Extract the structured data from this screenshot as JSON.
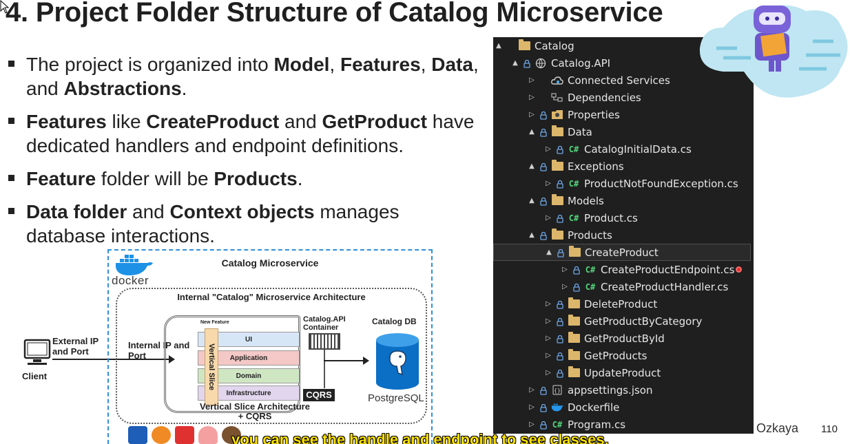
{
  "slide": {
    "title": "4. Project Folder Structure of Catalog Microservice",
    "page_number": "110",
    "author": "Ozkaya",
    "subtitle_caption": "you can see the handle and endpoint to see classes."
  },
  "bullets": [
    [
      {
        "t": "The project is organized into ",
        "b": false
      },
      {
        "t": "Model",
        "b": true
      },
      {
        "t": ", ",
        "b": false
      },
      {
        "t": "Features",
        "b": true
      },
      {
        "t": ", ",
        "b": false
      },
      {
        "t": "Data",
        "b": true
      },
      {
        "t": ", and ",
        "b": false
      },
      {
        "t": "Abstractions",
        "b": true
      },
      {
        "t": ".",
        "b": false
      }
    ],
    [
      {
        "t": "Features",
        "b": true
      },
      {
        "t": " like ",
        "b": false
      },
      {
        "t": "CreateProduct",
        "b": true
      },
      {
        "t": " and ",
        "b": false
      },
      {
        "t": "GetProduct",
        "b": true
      },
      {
        "t": " have dedicated handlers and endpoint definitions.",
        "b": false
      }
    ],
    [
      {
        "t": "Feature",
        "b": true
      },
      {
        "t": " folder will be ",
        "b": false
      },
      {
        "t": "Products",
        "b": true
      },
      {
        "t": ".",
        "b": false
      }
    ],
    [
      {
        "t": "Data folder",
        "b": true
      },
      {
        "t": " and ",
        "b": false
      },
      {
        "t": "Context objects",
        "b": true
      },
      {
        "t": " manages database interactions.",
        "b": false
      }
    ]
  ],
  "diagram": {
    "microservice_title": "Catalog Microservice",
    "docker_label": "docker",
    "inner_title": "Internal \"Catalog\" Microservice Architecture",
    "new_feature": "New Feature",
    "vertical_slice": "Vertical Slice",
    "layers": [
      "UI",
      "Application",
      "Domain",
      "Infrastructure"
    ],
    "caption": "Vertical Slice Architecture + CQRS",
    "cqrs": "CQRS",
    "api_container": "Catalog.API Container",
    "catalog_db": "Catalog DB",
    "postgres": "PostgreSQL",
    "internal_ip": "Internal IP and Port",
    "external_ip": "External IP and Port",
    "client": "Client"
  },
  "explorer": {
    "nodes": [
      {
        "label": "Catalog",
        "depth": 0,
        "exp": "▲",
        "icon": "folder",
        "lock": false
      },
      {
        "label": "Catalog.API",
        "depth": 1,
        "exp": "▲",
        "icon": "web",
        "lock": true
      },
      {
        "label": "Connected Services",
        "depth": 2,
        "exp": "▷",
        "icon": "cloud",
        "lock": false
      },
      {
        "label": "Dependencies",
        "depth": 2,
        "exp": "▷",
        "icon": "deps",
        "lock": false
      },
      {
        "label": "Properties",
        "depth": 2,
        "exp": "▷",
        "icon": "props",
        "lock": true
      },
      {
        "label": "Data",
        "depth": 2,
        "exp": "▲",
        "icon": "folder",
        "lock": true
      },
      {
        "label": "CatalogInitialData.cs",
        "depth": 3,
        "exp": "▷",
        "icon": "cs",
        "lock": true
      },
      {
        "label": "Exceptions",
        "depth": 2,
        "exp": "▲",
        "icon": "folder",
        "lock": true
      },
      {
        "label": "ProductNotFoundException.cs",
        "depth": 3,
        "exp": "▷",
        "icon": "cs",
        "lock": true
      },
      {
        "label": "Models",
        "depth": 2,
        "exp": "▲",
        "icon": "folder",
        "lock": true
      },
      {
        "label": "Product.cs",
        "depth": 3,
        "exp": "▷",
        "icon": "cs",
        "lock": true
      },
      {
        "label": "Products",
        "depth": 2,
        "exp": "▲",
        "icon": "folder",
        "lock": true
      },
      {
        "label": "CreateProduct",
        "depth": 3,
        "exp": "▲",
        "icon": "folder",
        "lock": true,
        "selected": true
      },
      {
        "label": "CreateProductEndpoint.cs",
        "depth": 4,
        "exp": "▷",
        "icon": "cs",
        "lock": true,
        "marker": true
      },
      {
        "label": "CreateProductHandler.cs",
        "depth": 4,
        "exp": "▷",
        "icon": "cs",
        "lock": true
      },
      {
        "label": "DeleteProduct",
        "depth": 3,
        "exp": "▷",
        "icon": "folder",
        "lock": true
      },
      {
        "label": "GetProductByCategory",
        "depth": 3,
        "exp": "▷",
        "icon": "folder",
        "lock": true
      },
      {
        "label": "GetProductById",
        "depth": 3,
        "exp": "▷",
        "icon": "folder",
        "lock": true
      },
      {
        "label": "GetProducts",
        "depth": 3,
        "exp": "▷",
        "icon": "folder",
        "lock": true
      },
      {
        "label": "UpdateProduct",
        "depth": 3,
        "exp": "▷",
        "icon": "folder",
        "lock": true
      },
      {
        "label": "appsettings.json",
        "depth": 2,
        "exp": "▷",
        "icon": "json",
        "lock": true
      },
      {
        "label": "Dockerfile",
        "depth": 2,
        "exp": "▷",
        "icon": "docker",
        "lock": true
      },
      {
        "label": "Program.cs",
        "depth": 2,
        "exp": "▷",
        "icon": "cs",
        "lock": true
      }
    ]
  },
  "colors": {
    "explorer_bg": "#1f1f1f",
    "folder": "#dcb66b",
    "csharp": "#54d47c",
    "dashed_border": "#2f8fd8",
    "subtitle": "#ffe100"
  }
}
